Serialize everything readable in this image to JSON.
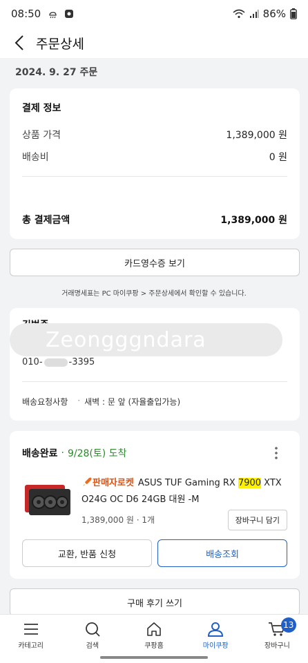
{
  "status_bar": {
    "time": "08:50",
    "battery": "86%"
  },
  "header": {
    "title": "주문상세"
  },
  "order_date": "2024. 9. 27 주문",
  "payment": {
    "title": "결제 정보",
    "rows": [
      {
        "label": "상품 가격",
        "value": "1,389,000 원"
      },
      {
        "label": "배송비",
        "value": "0 원"
      }
    ],
    "total_label": "총 결제금액",
    "total_value": "1,389,000 원"
  },
  "card_receipt_button": "카드영수증 보기",
  "notice": "거래명세표는 PC 마이쿠팡 > 주문상세에서 확인할 수 있습니다.",
  "address": {
    "name_partial": "김범준",
    "blurred_text": "Zeongggndara",
    "phone_prefix": "010-",
    "phone_suffix": "-3395",
    "request_label": "배송요청사항",
    "request_value": "새벽 : 문 앞 (자율출입가능)"
  },
  "delivery": {
    "status": "배송완료",
    "arrival": "9/28(토) 도착",
    "badge": "판매자로켓",
    "product_name_before": "ASUS TUF Gaming RX ",
    "product_name_highlight": "7900",
    "product_name_after": " XTX O24G OC D6 24GB 대원 -M",
    "price_qty": "1,389,000 원 · 1개",
    "cart_button": "장바구니 담기",
    "exchange_button": "교환, 반품 신청",
    "tracking_button": "배송조회"
  },
  "review_button": "구매 후기 쓰기",
  "tabs": [
    {
      "label": "카테고리",
      "icon": "menu-icon"
    },
    {
      "label": "검색",
      "icon": "search-icon"
    },
    {
      "label": "쿠팡홈",
      "icon": "home-icon"
    },
    {
      "label": "마이쿠팡",
      "icon": "person-icon"
    },
    {
      "label": "장바구니",
      "icon": "cart-icon",
      "badge": "13"
    }
  ],
  "colors": {
    "accent_blue": "#1f5fc7",
    "green": "#2a8a2a",
    "highlight": "#fff200"
  }
}
